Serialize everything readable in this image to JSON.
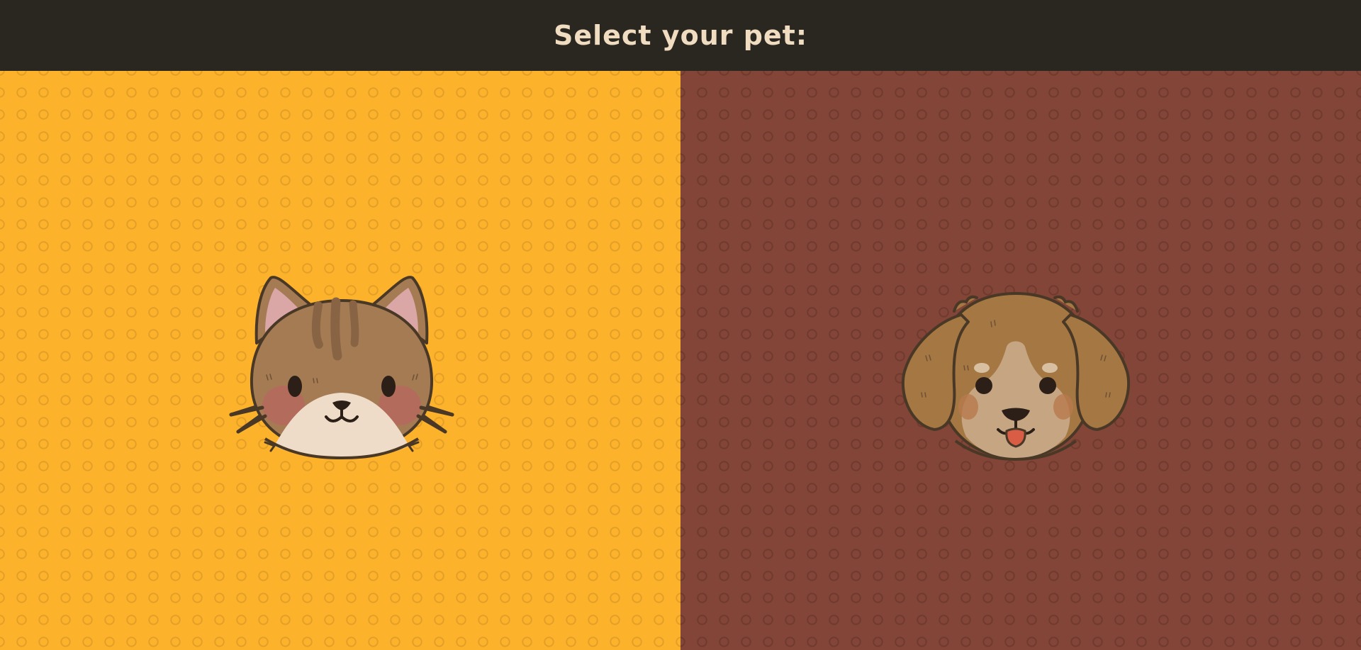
{
  "header": {
    "title": "Select your pet:"
  },
  "options": [
    {
      "id": "cat",
      "icon": "cat-face-icon",
      "background": "#fdb22b"
    },
    {
      "id": "dog",
      "icon": "dog-face-icon",
      "background": "#824537"
    }
  ],
  "colors": {
    "header_bg": "#2a2620",
    "header_text": "#f0dcc0",
    "cat_panel": "#fdb22b",
    "dog_panel": "#824537",
    "fur_brown": "#a57b54",
    "outline": "#4a3826"
  }
}
